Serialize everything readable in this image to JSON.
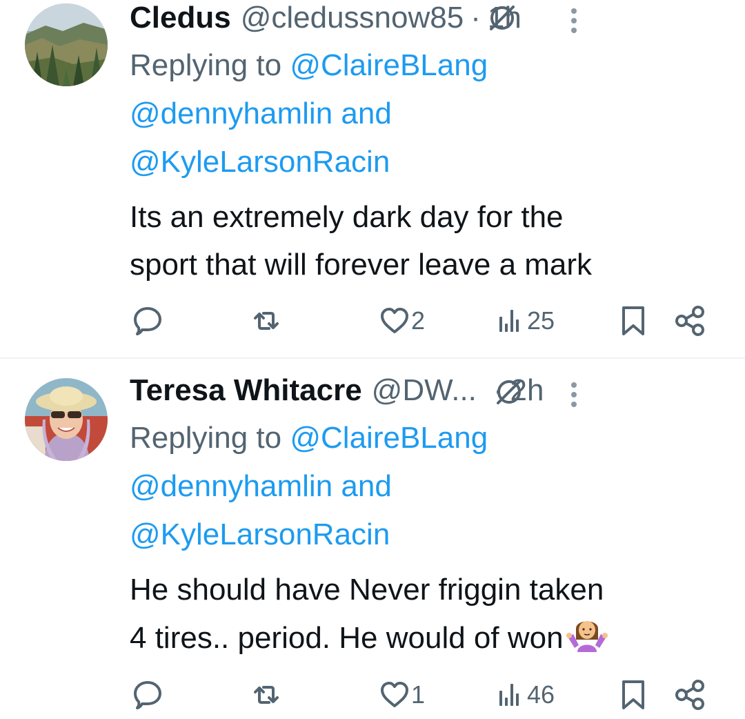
{
  "tweets": [
    {
      "name": "Cledus",
      "handle": "@cledussnow85",
      "separator": "·",
      "time": "1h",
      "reply_prefix": "Replying to ",
      "reply_mention_1": "@ClaireBLang",
      "reply_mention_2": "@dennyhamlin",
      "reply_and": " and",
      "reply_mention_3": "@KyleLarsonRacin",
      "text_line_1": "Its an extremely dark day for the",
      "text_line_2": "sport that will forever leave a mark",
      "likes": "2",
      "views": "25",
      "avatar_icon": "landscape-avatar"
    },
    {
      "name": "Teresa Whitacre",
      "handle": "@DW...",
      "separator": "·",
      "time": "2h",
      "reply_prefix": "Replying to ",
      "reply_mention_1": "@ClaireBLang",
      "reply_mention_2": "@dennyhamlin",
      "reply_and": " and",
      "reply_mention_3": "@KyleLarsonRacin",
      "text_line_1": "He should have Never friggin taken",
      "text_line_2": "4 tires.. period. He would of won",
      "likes": "1",
      "views": "46",
      "avatar_icon": "woman-with-hat-avatar",
      "emoji": "person-shrugging-emoji"
    }
  ],
  "colors": {
    "text": "#0f1419",
    "secondary": "#536471",
    "link": "#1d9bf0",
    "divider": "#eff3f4"
  },
  "icons": [
    "reply-icon",
    "retweet-icon",
    "like-icon",
    "views-icon",
    "bookmark-icon",
    "share-icon",
    "grok-icon",
    "more-icon"
  ]
}
